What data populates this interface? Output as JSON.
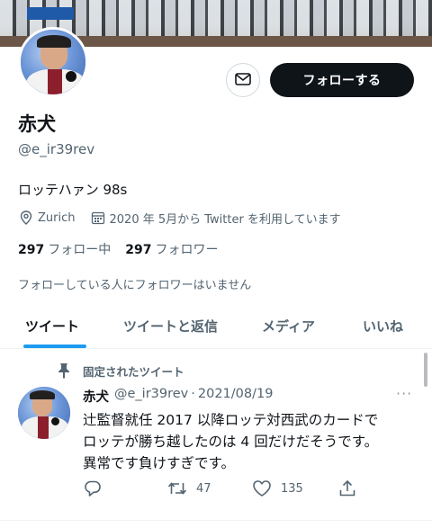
{
  "profile": {
    "name": "赤犬",
    "handle": "@e_ir39rev",
    "bio": "ロッテハァン 98s",
    "location": "Zurich",
    "joined": "2020 年 5月から Twitter を利用しています",
    "following_count": "297",
    "following_label": "フォロー中",
    "followers_count": "297",
    "followers_label": "フォロワー",
    "mutual_note": "フォローしている人にフォロワーはいません"
  },
  "actions": {
    "follow_label": "フォローする"
  },
  "tabs": [
    {
      "label": "ツイート",
      "active": true
    },
    {
      "label": "ツイートと返信",
      "active": false
    },
    {
      "label": "メディア",
      "active": false
    },
    {
      "label": "いいね",
      "active": false
    }
  ],
  "tweet": {
    "pinned_label": "固定されたツイート",
    "author": "赤犬",
    "handle": "@e_ir39rev",
    "separator": "·",
    "date": "2021/08/19",
    "more": "···",
    "lines": [
      "辻監督就任 2017 以降ロッテ対西武のカードで",
      "ロッテが勝ち越したのは 4 回だけだそうです。",
      "異常です負けすぎです。"
    ],
    "retweets": "47",
    "likes": "135"
  },
  "icons": {
    "mail": "mail-icon",
    "location": "location-pin-icon",
    "calendar": "calendar-icon",
    "pin": "pin-icon",
    "reply": "reply-icon",
    "retweet": "retweet-icon",
    "like": "heart-icon",
    "share": "share-icon"
  },
  "colors": {
    "accent": "#1d9bf0",
    "text": "#0f1419",
    "secondary": "#536471",
    "button": "#0f1419"
  }
}
